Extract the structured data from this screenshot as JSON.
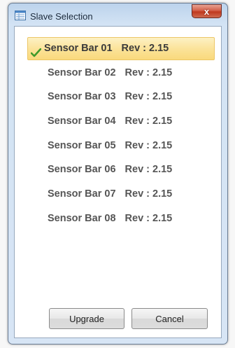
{
  "window": {
    "title": "Slave Selection",
    "close_glyph": "x",
    "title_icon": "window-list-icon"
  },
  "slave_list": {
    "items": [
      {
        "name": "Sensor Bar 01",
        "rev": "Rev : 2.15",
        "selected": true
      },
      {
        "name": "Sensor Bar 02",
        "rev": "Rev : 2.15",
        "selected": false
      },
      {
        "name": "Sensor Bar 03",
        "rev": "Rev : 2.15",
        "selected": false
      },
      {
        "name": "Sensor Bar 04",
        "rev": "Rev : 2.15",
        "selected": false
      },
      {
        "name": "Sensor Bar 05",
        "rev": "Rev : 2.15",
        "selected": false
      },
      {
        "name": "Sensor Bar 06",
        "rev": "Rev : 2.15",
        "selected": false
      },
      {
        "name": "Sensor Bar 07",
        "rev": "Rev : 2.15",
        "selected": false
      },
      {
        "name": "Sensor Bar 08",
        "rev": "Rev : 2.15",
        "selected": false
      }
    ],
    "selected_icon": "check-icon"
  },
  "buttons": {
    "upgrade_label": "Upgrade",
    "cancel_label": "Cancel"
  },
  "colors": {
    "selection_highlight": "#f9d97c",
    "check": "#3f9a2a",
    "item_text": "#555555",
    "close_button": "#c0391f"
  }
}
